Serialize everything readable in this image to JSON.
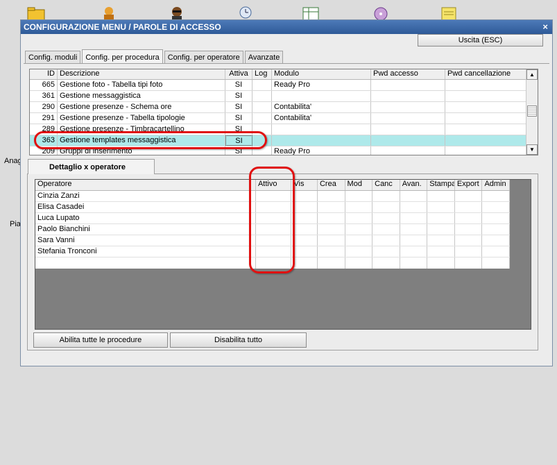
{
  "window": {
    "title": "CONFIGURAZIONE MENU / PAROLE DI ACCESSO",
    "close_label": "×",
    "exit_label": "Uscita (ESC)"
  },
  "side_labels": [
    "Anag",
    "Pia"
  ],
  "tabs": [
    {
      "label": "Config. moduli"
    },
    {
      "label": "Config. per procedura"
    },
    {
      "label": "Config. per operatore"
    },
    {
      "label": "Avanzate"
    }
  ],
  "procedures": {
    "columns": [
      "ID",
      "Descrizione",
      "Attiva",
      "Log",
      "Modulo",
      "Pwd accesso",
      "Pwd cancellazione"
    ],
    "rows": [
      {
        "id": "665",
        "desc": "Gestione foto - Tabella tipi foto",
        "att": "SI",
        "log": "",
        "mod": "Ready Pro",
        "pwd": "",
        "pwdc": ""
      },
      {
        "id": "361",
        "desc": "Gestione messaggistica",
        "att": "SI",
        "log": "",
        "mod": "",
        "pwd": "",
        "pwdc": ""
      },
      {
        "id": "290",
        "desc": "Gestione presenze - Schema ore",
        "att": "SI",
        "log": "",
        "mod": "Contabilita'",
        "pwd": "",
        "pwdc": ""
      },
      {
        "id": "291",
        "desc": "Gestione presenze - Tabella tipologie",
        "att": "SI",
        "log": "",
        "mod": "Contabilita'",
        "pwd": "",
        "pwdc": ""
      },
      {
        "id": "289",
        "desc": "Gestione presenze - Timbracartellino",
        "att": "SI",
        "log": "",
        "mod": "",
        "pwd": "",
        "pwdc": ""
      },
      {
        "id": "363",
        "desc": "Gestione templates messaggistica",
        "att": "SI",
        "log": "",
        "mod": "",
        "pwd": "",
        "pwdc": ""
      },
      {
        "id": "209",
        "desc": "Gruppi di inserimento",
        "att": "SI",
        "log": "",
        "mod": "Ready Pro",
        "pwd": "",
        "pwdc": ""
      }
    ]
  },
  "inner_tab": "Dettaglio x operatore",
  "operators": {
    "columns": [
      "Operatore",
      "Attivo",
      "Vis",
      "Crea",
      "Mod",
      "Canc",
      "Avan.",
      "Stampa",
      "Export",
      "Admin"
    ],
    "rows": [
      "Cinzia Zanzi",
      "Elisa Casadei",
      "Luca Lupato",
      "Paolo Bianchini",
      "Sara Vanni",
      "Stefania Tronconi"
    ]
  },
  "buttons": {
    "enable_all": "Abilita tutte le procedure",
    "disable_all": "Disabilita tutto"
  }
}
